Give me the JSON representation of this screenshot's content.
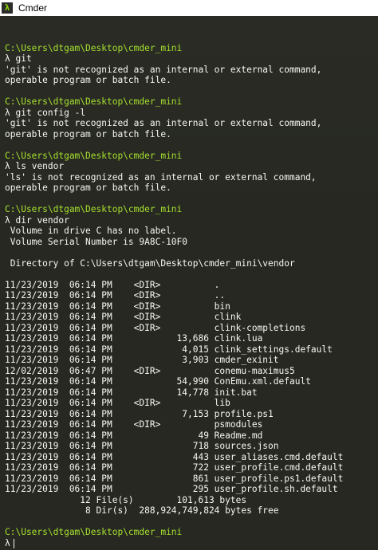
{
  "window": {
    "title": "Cmder",
    "icon": "lambda-icon"
  },
  "colors": {
    "background": "#272822",
    "path_green": "#a6e22e",
    "text": "#f8f8f2"
  },
  "console": {
    "prompt_symbol": "λ",
    "blocks": [
      {
        "path": "C:\\Users\\dtgam\\Desktop\\cmder_mini",
        "command": "git",
        "output": [
          "'git' is not recognized as an internal or external command,",
          "operable program or batch file."
        ]
      },
      {
        "path": "C:\\Users\\dtgam\\Desktop\\cmder_mini",
        "command": "git config -l",
        "output": [
          "'git' is not recognized as an internal or external command,",
          "operable program or batch file."
        ]
      },
      {
        "path": "C:\\Users\\dtgam\\Desktop\\cmder_mini",
        "command": "ls vendor",
        "output": [
          "'ls' is not recognized as an internal or external command,",
          "operable program or batch file."
        ]
      },
      {
        "path": "C:\\Users\\dtgam\\Desktop\\cmder_mini",
        "command": "dir vendor",
        "output": [
          " Volume in drive C has no label.",
          " Volume Serial Number is 9A8C-10F0",
          "",
          " Directory of C:\\Users\\dtgam\\Desktop\\cmder_mini\\vendor",
          "",
          "11/23/2019  06:14 PM    <DIR>          .",
          "11/23/2019  06:14 PM    <DIR>          ..",
          "11/23/2019  06:14 PM    <DIR>          bin",
          "11/23/2019  06:14 PM    <DIR>          clink",
          "11/23/2019  06:14 PM    <DIR>          clink-completions",
          "11/23/2019  06:14 PM            13,686 clink.lua",
          "11/23/2019  06:14 PM             4,015 clink_settings.default",
          "11/23/2019  06:14 PM             3,903 cmder_exinit",
          "12/02/2019  06:47 PM    <DIR>          conemu-maximus5",
          "11/23/2019  06:14 PM            54,990 ConEmu.xml.default",
          "11/23/2019  06:14 PM            14,778 init.bat",
          "11/23/2019  06:14 PM    <DIR>          lib",
          "11/23/2019  06:14 PM             7,153 profile.ps1",
          "11/23/2019  06:14 PM    <DIR>          psmodules",
          "11/23/2019  06:14 PM                49 Readme.md",
          "11/23/2019  06:14 PM               718 sources.json",
          "11/23/2019  06:14 PM               443 user_aliases.cmd.default",
          "11/23/2019  06:14 PM               722 user_profile.cmd.default",
          "11/23/2019  06:14 PM               861 user_profile.ps1.default",
          "11/23/2019  06:14 PM               295 user_profile.sh.default",
          "              12 File(s)        101,613 bytes",
          "               8 Dir(s)  288,924,749,824 bytes free"
        ]
      }
    ],
    "current": {
      "path": "C:\\Users\\dtgam\\Desktop\\cmder_mini",
      "command": ""
    }
  }
}
